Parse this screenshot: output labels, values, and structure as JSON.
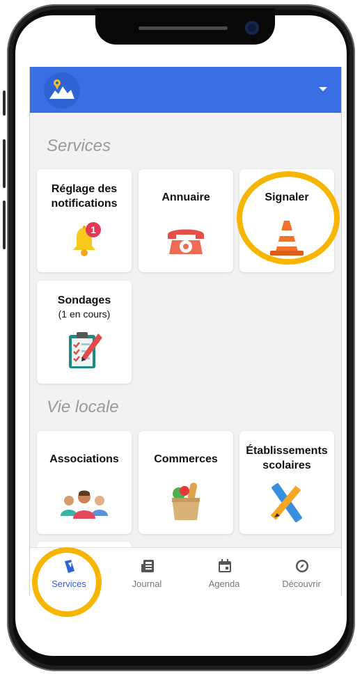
{
  "section_services": "Services",
  "section_vie_locale": "Vie locale",
  "cards": {
    "notifications": {
      "label_line1": "Réglage des",
      "label_line2": "notifications",
      "badge": "1"
    },
    "annuaire": {
      "label": "Annuaire"
    },
    "signaler": {
      "label": "Signaler"
    },
    "sondages": {
      "label": "Sondages",
      "sub": "(1 en cours)"
    },
    "associations": {
      "label": "Associations"
    },
    "commerces": {
      "label": "Commerces"
    },
    "etablissements": {
      "label_line1": "Établissements",
      "label_line2": "scolaires"
    }
  },
  "nav": {
    "services": "Services",
    "journal": "Journal",
    "agenda": "Agenda",
    "decouvrir": "Découvrir"
  },
  "colors": {
    "appbar": "#3a6fe3",
    "highlight": "#f7b500",
    "active_nav": "#2f62d3",
    "badge": "#e03a57"
  }
}
